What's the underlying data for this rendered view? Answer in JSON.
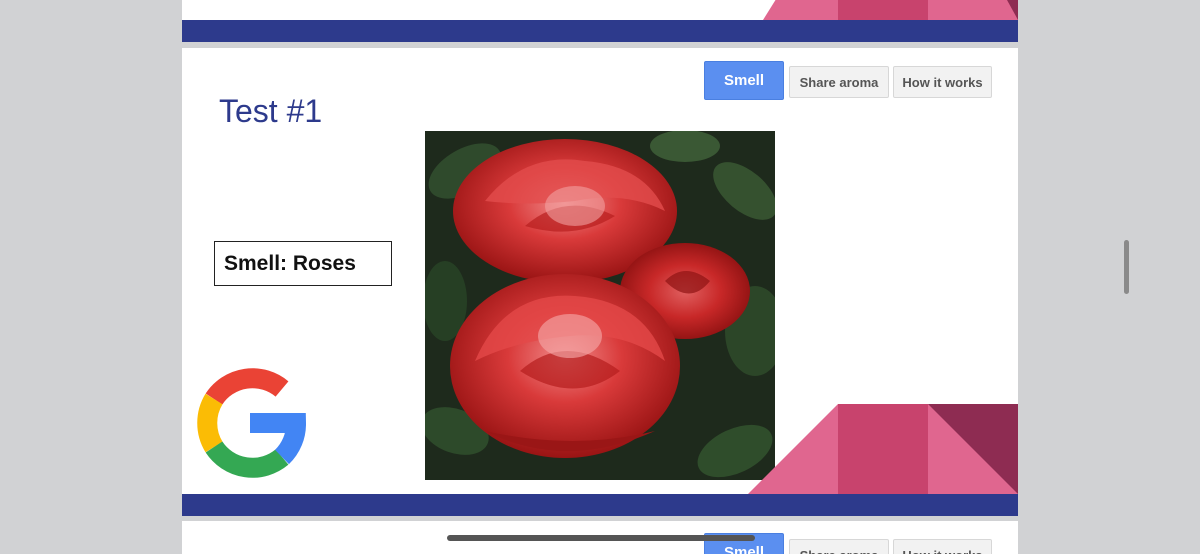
{
  "toolbar": {
    "smell_label": "Smell",
    "share_label": "Share aroma",
    "how_label": "How it works"
  },
  "slide": {
    "title": "Test #1",
    "smell_label": "Smell: Roses"
  },
  "colors": {
    "page_bg": "#d1d2d4",
    "slide_bg": "#ffffff",
    "bar_navy": "#2d3a8c",
    "accent_pink": "#e0668f",
    "accent_rose": "#c8436d",
    "accent_maroon": "#8e2c52",
    "button_blue": "#5b8ff0"
  },
  "icons": {
    "logo": "google-g-logo",
    "photo": "red-roses-photo"
  }
}
